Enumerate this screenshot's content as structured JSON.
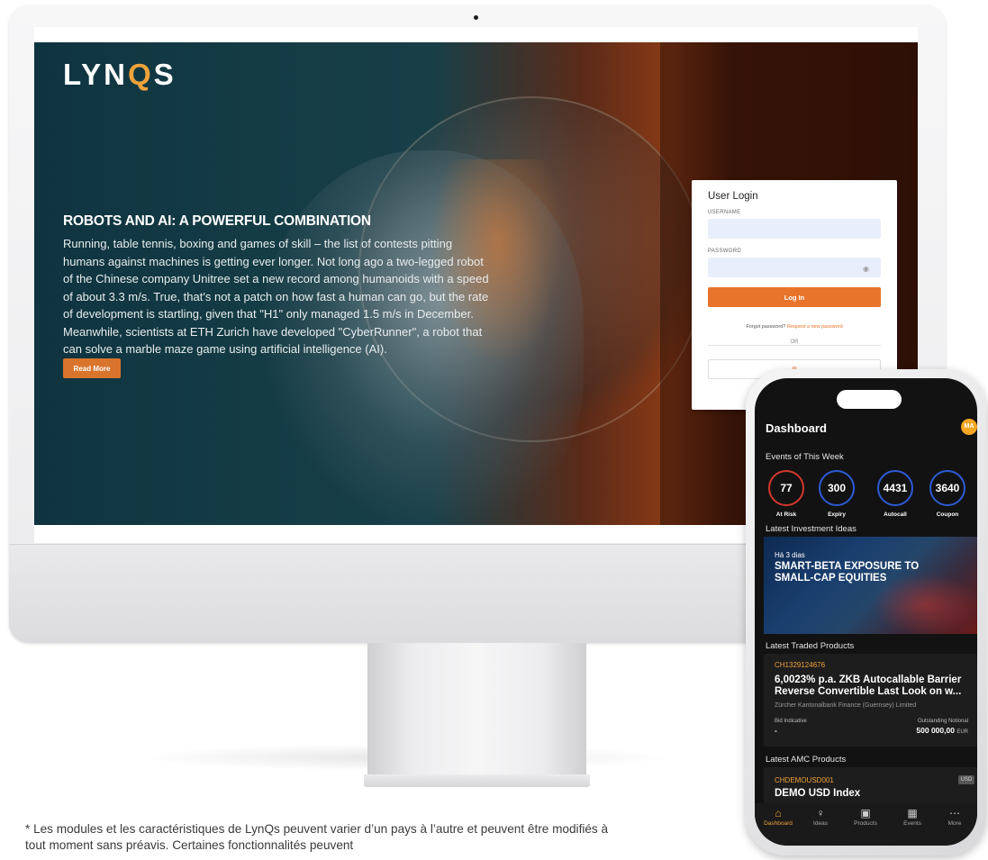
{
  "website": {
    "logo": {
      "prefix": "LYN",
      "accent": "Q",
      "suffix": "S"
    },
    "hero": {
      "title": "ROBOTS AND AI: A POWERFUL COMBINATION",
      "body": "Running, table tennis, boxing and games of skill – the list of contests pitting humans against machines is getting ever longer. Not long ago a two-legged robot of the Chinese company Unitree set a new record among humanoids with a speed of about 3.3 m/s. True, that's not a patch on how fast a human can go, but the rate of development is startling, given that \"H1\" only managed 1.5 m/s in December. Meanwhile, scientists at ETH Zurich have developed \"CyberRunner\", a robot that can solve a marble maze game using artificial intelligence (AI).",
      "read_more_label": "Read More"
    },
    "login": {
      "title": "User Login",
      "username_label": "USERNAME",
      "password_label": "PASSWORD",
      "login_button": "Log In",
      "forgot_text": "Forgot password?",
      "forgot_link": "Request a new password",
      "or_text": "OR"
    }
  },
  "footnote": "* Les modules et les caractéristiques de LynQs peuvent varier d’un pays à l’autre et peuvent être modifiés à tout moment sans préavis. Certaines fonctionnalités peuvent",
  "mobile": {
    "title": "Dashboard",
    "avatar_initials": "MA",
    "events": {
      "title": "Events of This Week",
      "items": [
        {
          "value": "77",
          "label": "At Risk"
        },
        {
          "value": "300",
          "label": "Expiry"
        },
        {
          "value": "4431",
          "label": "Autocall"
        },
        {
          "value": "3640",
          "label": "Coupon"
        }
      ]
    },
    "investment_ideas": {
      "title": "Latest Investment Ideas",
      "time": "Há 3 dias",
      "idea_title": "SMART-BETA EXPOSURE TO SMALL-CAP EQUITIES"
    },
    "traded": {
      "title": "Latest Traded Products",
      "isin": "CH1329124676",
      "name": "6,0023% p.a. ZKB Autocallable Barrier Reverse Convertible Last Look on w...",
      "issuer": "Zürcher Kantonalbank Finance (Guernsey) Limited",
      "bid_label": "Bid Indicative",
      "bid_value": "-",
      "notional_label": "Outstanding Notional",
      "notional_value": "500 000,00",
      "notional_currency": "EUR"
    },
    "amc": {
      "title": "Latest AMC Products",
      "isin": "CHDEMOUSD001",
      "badge": "USD",
      "name": "DEMO USD Index"
    },
    "tabs": [
      {
        "label": "Dashboard",
        "icon": "home-icon",
        "active": true
      },
      {
        "label": "Ideas",
        "icon": "lightbulb-icon",
        "active": false
      },
      {
        "label": "Products",
        "icon": "briefcase-icon",
        "active": false
      },
      {
        "label": "Events",
        "icon": "calendar-icon",
        "active": false
      },
      {
        "label": "More",
        "icon": "more-icon",
        "active": false
      }
    ]
  },
  "colors": {
    "brand_orange": "#e8742b",
    "ring_red": "#d3382d",
    "ring_blue": "#2e5bd6",
    "accent_amber": "#f0a23a"
  }
}
